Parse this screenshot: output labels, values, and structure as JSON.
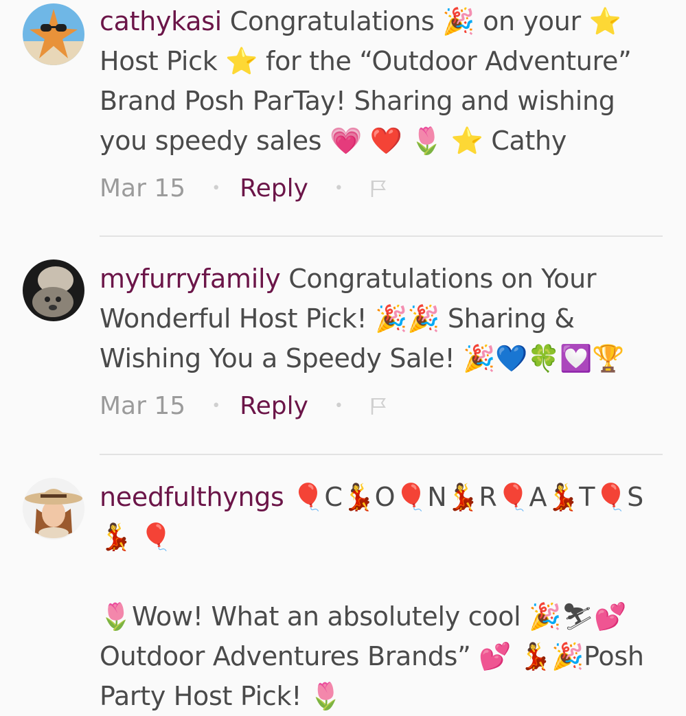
{
  "comments": [
    {
      "username": "cathykasi",
      "text": " Congratulations 🎉 on your ⭐ Host Pick ⭐ for the “Outdoor Adventure” Brand Posh ParTay! Sharing and wishing you speedy sales 💗 ❤️ 🌷 ⭐ Cathy",
      "date": "Mar 15",
      "reply_label": "Reply",
      "avatar_icon": "starfish-sunglasses-avatar"
    },
    {
      "username": "myfurryfamily",
      "text": " Congratulations on Your Wonderful Host Pick! 🎉🎉 Sharing & Wishing You a Speedy Sale! 🎉💙🍀💟🏆",
      "date": "Mar 15",
      "reply_label": "Reply",
      "avatar_icon": "dogs-photo-avatar"
    },
    {
      "username": "needfulthyngs",
      "text": " 🎈C💃O🎈N💃R🎈A💃T🎈S💃 🎈",
      "text2": "🌷Wow! What an absolutely cool 🎉⛷💕Outdoor Adventures Brands” 💕 💃🎉Posh Party Host Pick! 🌷",
      "avatar_icon": "woman-sun-hat-avatar"
    }
  ],
  "icons": {
    "flag": "flag-icon",
    "separator": "•"
  },
  "colors": {
    "username": "#6b1548",
    "reply": "#6b1548",
    "body_text": "#4a4a4a",
    "date": "#9b9b9b",
    "divider": "#e2e2e2",
    "background": "#fafafa"
  }
}
